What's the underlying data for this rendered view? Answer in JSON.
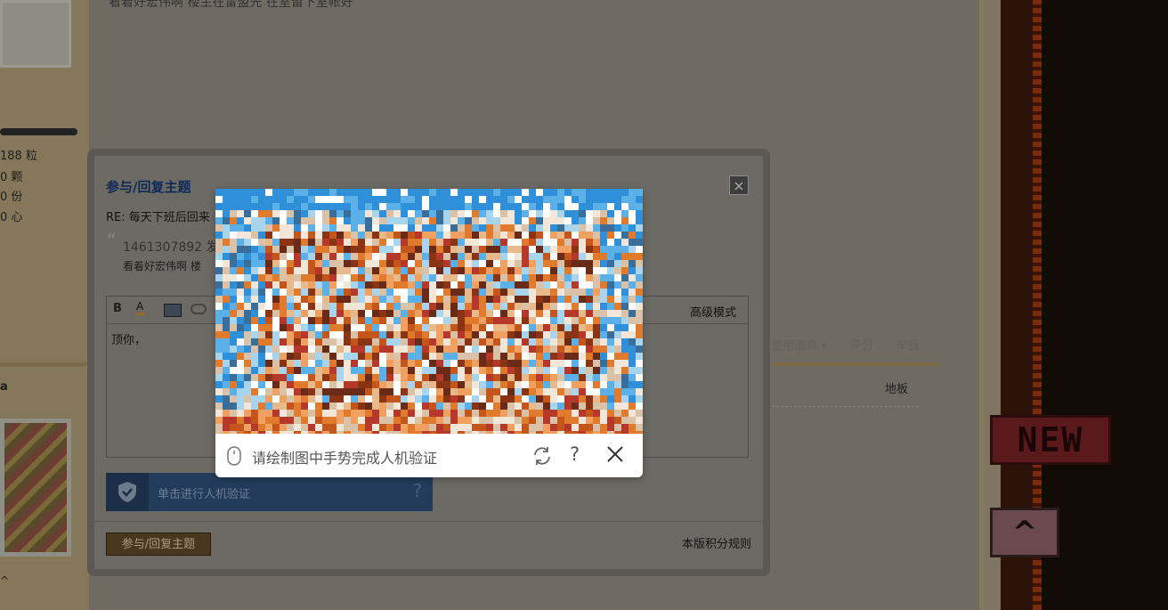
{
  "background": {
    "top_line": "看着好宏伟啊 楼主在雷盟先 在室留下室帐好",
    "stats": [
      "188 粒",
      "0 颗",
      "0 份",
      "0 心"
    ],
    "username": "a",
    "floor_label": "地板",
    "tools": [
      "使用道具 ▾",
      "评分",
      "举报"
    ],
    "caret": "^",
    "new_badge": "NEW",
    "up_badge": "^"
  },
  "reply_dialog": {
    "title": "参与/回复主题",
    "close_label": "×",
    "subject": "RE: 每天下班后回来",
    "quote_mark": "“",
    "quote_author": "1461307892 发",
    "quote_text": "看着好宏伟啊  楼",
    "editor": {
      "bold_label": "B",
      "color_label": "A",
      "advanced_mode": "高级模式",
      "content": "顶你，"
    },
    "captcha_button_label": "单击进行人机验证",
    "captcha_help": "?",
    "submit_label": "参与/回复主题",
    "rules_link": "本版积分规则"
  },
  "captcha_popup": {
    "prompt": "请绘制图中手势完成人机验证",
    "help_label": "?"
  },
  "colors": {
    "overlay": "#6e6a62",
    "popup_bg": "#ffffff",
    "captcha_button": "#233c5c",
    "submit_button": "#4a3720"
  },
  "icons": [
    "mouse-icon",
    "refresh-icon",
    "help-icon",
    "close-icon",
    "shield-check-icon",
    "bold-icon",
    "font-color-icon",
    "image-icon",
    "link-icon"
  ]
}
